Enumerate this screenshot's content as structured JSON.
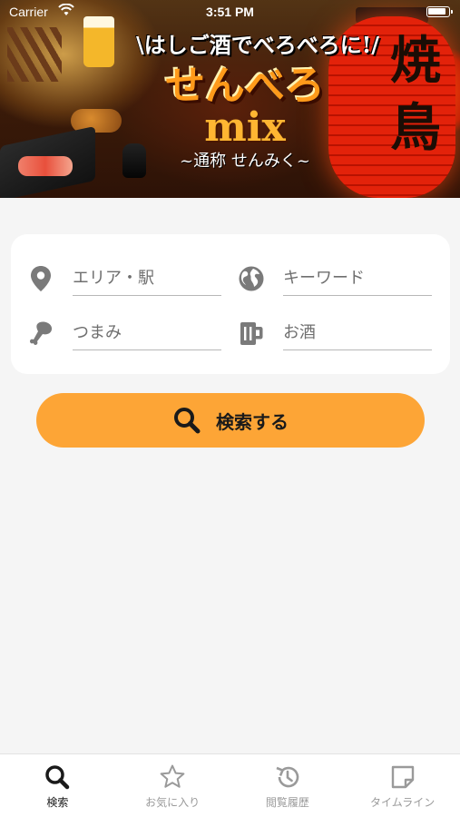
{
  "status_bar": {
    "carrier": "Carrier",
    "time": "3:51 PM"
  },
  "banner": {
    "tagline": "\\はしご酒でべろべろに!/",
    "title_main": "せんべろ",
    "title_mix": "mix",
    "subtitle": "~通称 せんみく~",
    "lantern_text": "焼鳥"
  },
  "search": {
    "area": {
      "placeholder": "エリア・駅",
      "icon": "map-pin-icon"
    },
    "keyword": {
      "placeholder": "キーワード",
      "icon": "globe-icon"
    },
    "tsumami": {
      "placeholder": "つまみ",
      "icon": "chicken-leg-icon"
    },
    "sake": {
      "placeholder": "お酒",
      "icon": "beer-mug-icon"
    },
    "button_label": "検索する"
  },
  "tabs": [
    {
      "label": "検索",
      "icon": "search-icon",
      "active": true
    },
    {
      "label": "お気に入り",
      "icon": "star-icon",
      "active": false
    },
    {
      "label": "閲覧履歴",
      "icon": "history-icon",
      "active": false
    },
    {
      "label": "タイムライン",
      "icon": "note-icon",
      "active": false
    }
  ],
  "colors": {
    "accent": "#fda536",
    "background": "#f5f5f5",
    "icon_gray": "#7a7a7a",
    "tab_active": "#1a1a1a",
    "tab_inactive": "#9a9a9a"
  }
}
